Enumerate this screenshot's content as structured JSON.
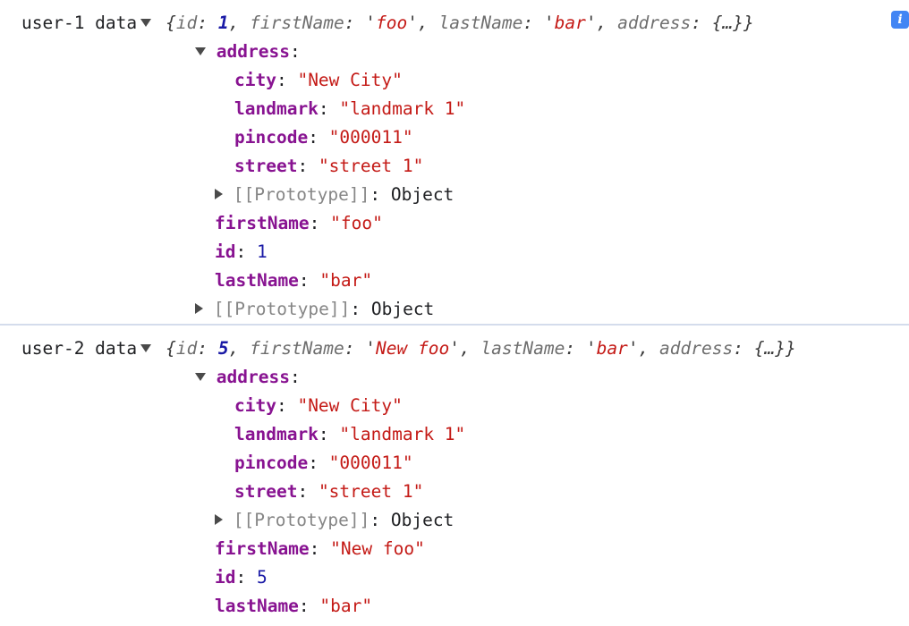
{
  "theme": {
    "background": "#ffffff",
    "key_color": "#881391",
    "string_color": "#c41a16",
    "number_color": "#1a1aa6",
    "proto_color": "#868686",
    "text_color": "#202124",
    "divider_color": "#d4dcec",
    "info_badge_color": "#4285f4"
  },
  "icons": {
    "expanded": "▼",
    "collapsed": "▶",
    "info": "i"
  },
  "entries": [
    {
      "label": "user-1 data",
      "expanded": true,
      "info_badge": "i",
      "preview": {
        "open": "{",
        "tokens": [
          {
            "key": "id",
            "sep": ": ",
            "value": "1",
            "type": "number",
            "trail": ", "
          },
          {
            "key": "firstName",
            "sep": ": ",
            "value": "foo",
            "type": "string",
            "quote": "'",
            "trail": ", "
          },
          {
            "key": "lastName",
            "sep": ": ",
            "value": "bar",
            "type": "string",
            "quote": "'",
            "trail": ", "
          },
          {
            "key": "address",
            "sep": ": ",
            "value": "{…}",
            "type": "object",
            "trail": ""
          }
        ],
        "close": "}"
      },
      "rows": [
        {
          "indent": 1,
          "arrow": "expanded",
          "key": "address",
          "sep": ":",
          "value": "",
          "type": "none"
        },
        {
          "indent": 3,
          "arrow": "none",
          "key": "city",
          "sep": ": ",
          "value": "\"New City\"",
          "type": "string"
        },
        {
          "indent": 3,
          "arrow": "none",
          "key": "landmark",
          "sep": ": ",
          "value": "\"landmark 1\"",
          "type": "string"
        },
        {
          "indent": 3,
          "arrow": "none",
          "key": "pincode",
          "sep": ": ",
          "value": "\"000011\"",
          "type": "string"
        },
        {
          "indent": 3,
          "arrow": "none",
          "key": "street",
          "sep": ": ",
          "value": "\"street 1\"",
          "type": "string"
        },
        {
          "indent": 2,
          "arrow": "collapsed",
          "key": "[[Prototype]]",
          "sep": ": ",
          "value": "Object",
          "type": "proto"
        },
        {
          "indent": 2,
          "arrow": "none",
          "key": "firstName",
          "sep": ": ",
          "value": "\"foo\"",
          "type": "string"
        },
        {
          "indent": 2,
          "arrow": "none",
          "key": "id",
          "sep": ": ",
          "value": "1",
          "type": "number"
        },
        {
          "indent": 2,
          "arrow": "none",
          "key": "lastName",
          "sep": ": ",
          "value": "\"bar\"",
          "type": "string"
        },
        {
          "indent": 1,
          "arrow": "collapsed",
          "key": "[[Prototype]]",
          "sep": ": ",
          "value": "Object",
          "type": "proto"
        }
      ]
    },
    {
      "label": "user-2 data",
      "expanded": true,
      "info_badge": null,
      "preview": {
        "open": "{",
        "tokens": [
          {
            "key": "id",
            "sep": ": ",
            "value": "5",
            "type": "number",
            "trail": ", "
          },
          {
            "key": "firstName",
            "sep": ": ",
            "value": "New foo",
            "type": "string",
            "quote": "'",
            "trail": ", "
          },
          {
            "key": "lastName",
            "sep": ": ",
            "value": "bar",
            "type": "string",
            "quote": "'",
            "trail": ", "
          },
          {
            "key": "address",
            "sep": ": ",
            "value": "{…}",
            "type": "object",
            "trail": ""
          }
        ],
        "close": "}"
      },
      "rows": [
        {
          "indent": 1,
          "arrow": "expanded",
          "key": "address",
          "sep": ":",
          "value": "",
          "type": "none"
        },
        {
          "indent": 3,
          "arrow": "none",
          "key": "city",
          "sep": ": ",
          "value": "\"New City\"",
          "type": "string"
        },
        {
          "indent": 3,
          "arrow": "none",
          "key": "landmark",
          "sep": ": ",
          "value": "\"landmark 1\"",
          "type": "string"
        },
        {
          "indent": 3,
          "arrow": "none",
          "key": "pincode",
          "sep": ": ",
          "value": "\"000011\"",
          "type": "string"
        },
        {
          "indent": 3,
          "arrow": "none",
          "key": "street",
          "sep": ": ",
          "value": "\"street 1\"",
          "type": "string"
        },
        {
          "indent": 2,
          "arrow": "collapsed",
          "key": "[[Prototype]]",
          "sep": ": ",
          "value": "Object",
          "type": "proto"
        },
        {
          "indent": 2,
          "arrow": "none",
          "key": "firstName",
          "sep": ": ",
          "value": "\"New foo\"",
          "type": "string"
        },
        {
          "indent": 2,
          "arrow": "none",
          "key": "id",
          "sep": ": ",
          "value": "5",
          "type": "number"
        },
        {
          "indent": 2,
          "arrow": "none",
          "key": "lastName",
          "sep": ": ",
          "value": "\"bar\"",
          "type": "string"
        }
      ]
    }
  ]
}
